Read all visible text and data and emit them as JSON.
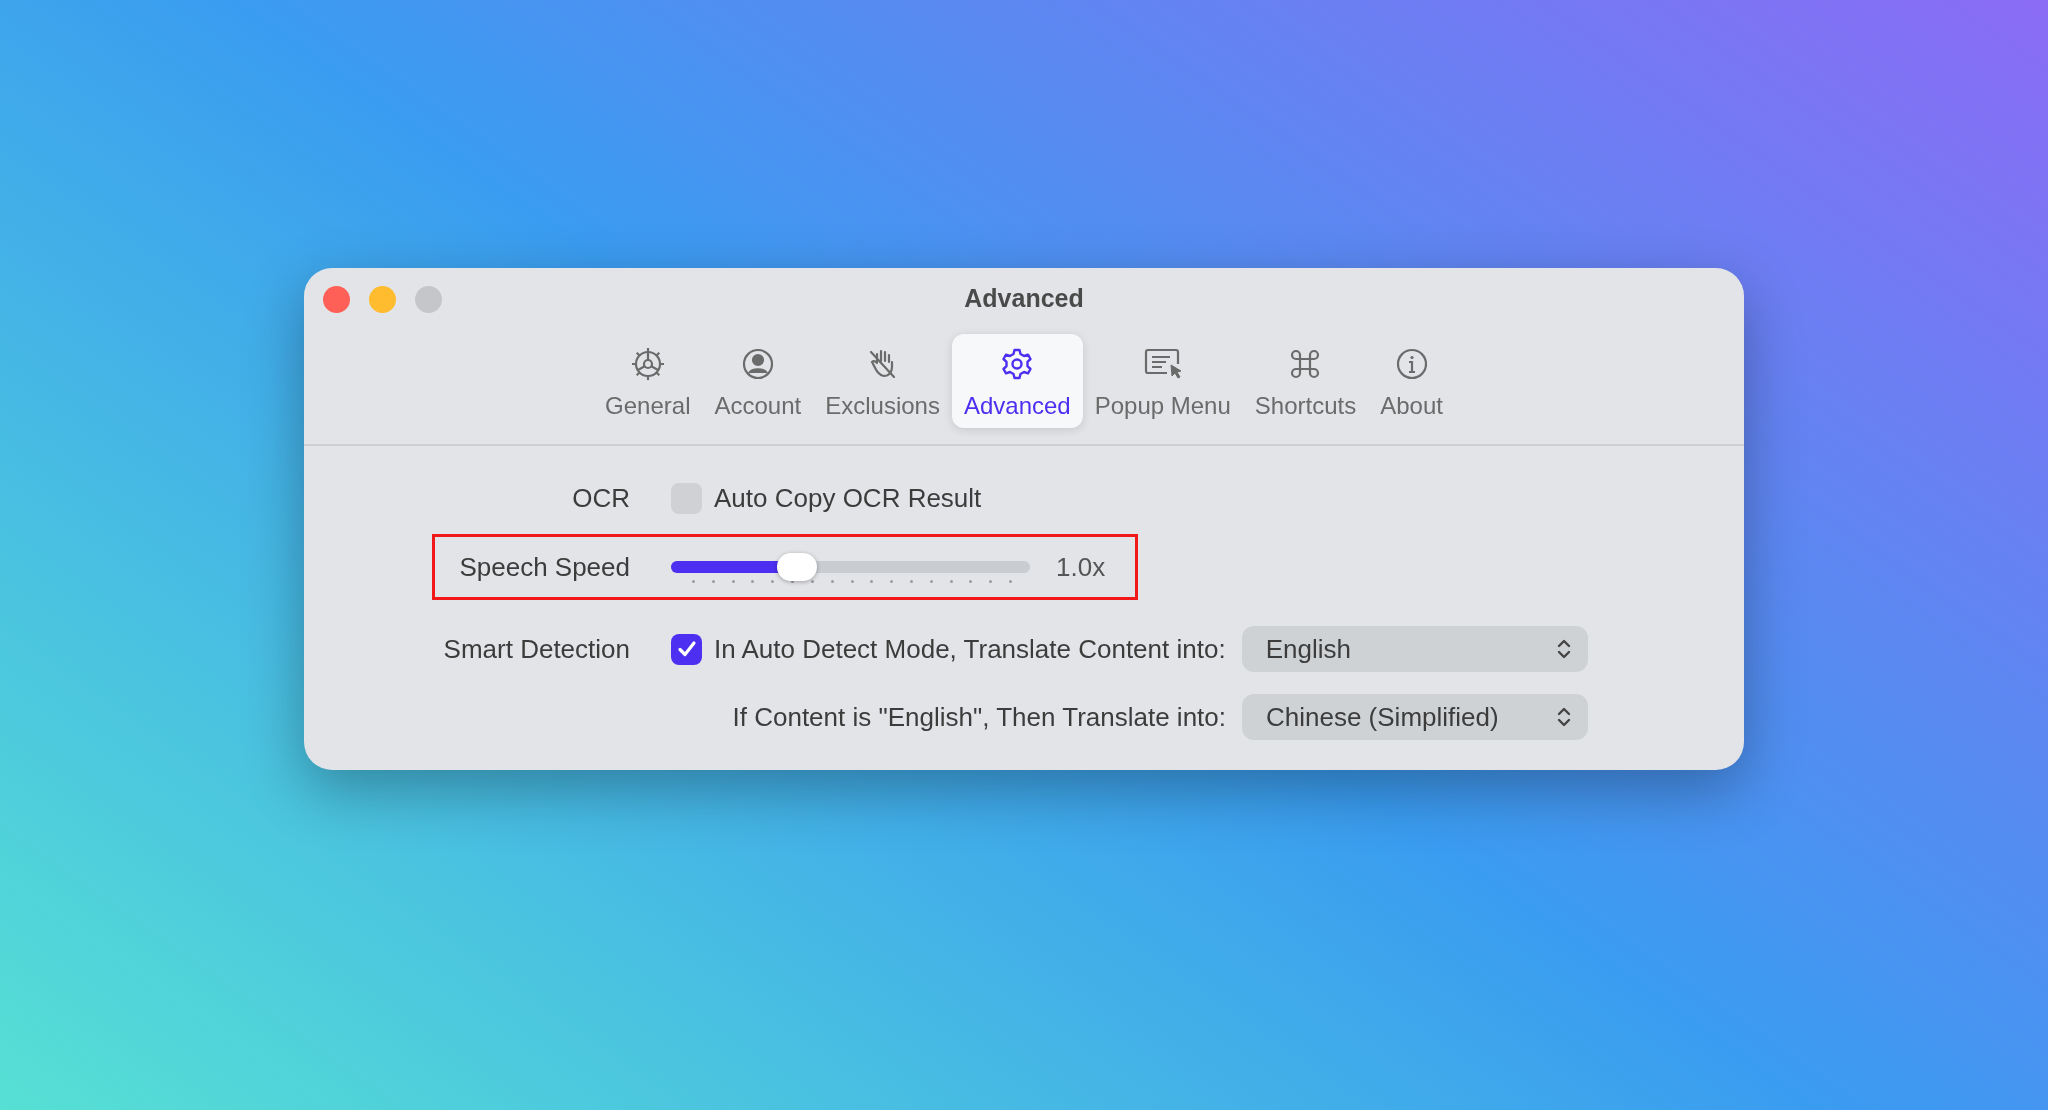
{
  "window": {
    "title": "Advanced"
  },
  "tabs": [
    {
      "label": "General",
      "selected": false
    },
    {
      "label": "Account",
      "selected": false
    },
    {
      "label": "Exclusions",
      "selected": false
    },
    {
      "label": "Advanced",
      "selected": true
    },
    {
      "label": "Popup Menu",
      "selected": false
    },
    {
      "label": "Shortcuts",
      "selected": false
    },
    {
      "label": "About",
      "selected": false
    }
  ],
  "ocr": {
    "label": "OCR",
    "checked": false,
    "text": "Auto Copy OCR Result"
  },
  "speech_speed": {
    "label": "Speech Speed",
    "level": 0.35,
    "reading": "1.0x",
    "highlighted": true
  },
  "smart_detection": {
    "label": "Smart Detection",
    "checked": true,
    "text": "In Auto Detect Mode, Translate Content into:",
    "select": "English"
  },
  "english_rule": {
    "text": "If Content is \"English\", Then Translate into:",
    "select": "Chinese (Simplified)"
  }
}
